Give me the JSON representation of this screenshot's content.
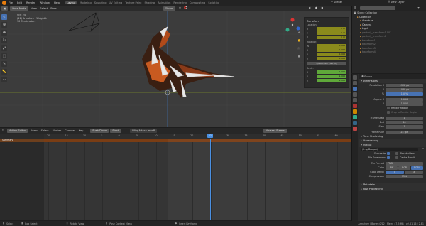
{
  "topbar": {
    "menus": [
      "File",
      "Edit",
      "Render",
      "Window",
      "Help"
    ],
    "tabs": [
      "Layout",
      "Modeling",
      "Sculpting",
      "UV Editing",
      "Texture Paint",
      "Shading",
      "Animation",
      "Rendering",
      "Compositing",
      "Scripting"
    ],
    "active_tab": "Layout",
    "scene": "Scene",
    "view_layer": "View Layer"
  },
  "viewport": {
    "mode": "Pose Mode",
    "menus": [
      "View",
      "Select",
      "Pose"
    ],
    "orientation": "Global",
    "info_line1": "Scr: 24",
    "info_line2": "(11) Armature : Weight L",
    "info_line3": "10 Centimeters",
    "npanel": {
      "title": "Transform",
      "location_label": "Location:",
      "location": [
        "0 m",
        "0 m",
        "0 m"
      ],
      "rotation_label": "Rotation:",
      "rotation": [
        "0.000",
        "0.000",
        "0.000",
        "0.000"
      ],
      "quaternion": "Quaternion (WXYZ)",
      "scale_label": "Scale:",
      "scale": [
        "1.000",
        "1.000",
        "1.000"
      ],
      "axes": [
        "X",
        "Y",
        "Z",
        "W"
      ]
    }
  },
  "outliner": {
    "title": "Scene Collection",
    "items": [
      {
        "label": "Collection",
        "indent": 1,
        "color": "#ddd"
      },
      {
        "label": "Armature",
        "indent": 2,
        "color": "#ddd"
      },
      {
        "label": "Camera",
        "indent": 2,
        "color": "#ddd"
      },
      {
        "label": "Light",
        "indent": 2,
        "color": "#ddd"
      },
      {
        "label": "pasted__transform1.001",
        "indent": 2,
        "color": "#777"
      },
      {
        "label": "pasted__transform6",
        "indent": 2,
        "color": "#777"
      },
      {
        "label": "transform1",
        "indent": 2,
        "color": "#777"
      },
      {
        "label": "transform2",
        "indent": 2,
        "color": "#777"
      },
      {
        "label": "transform3",
        "indent": 2,
        "color": "#777"
      },
      {
        "label": "transform4",
        "indent": 2,
        "color": "#777"
      }
    ]
  },
  "properties": {
    "scene_label": "Scene",
    "dimensions": "Dimensions",
    "res_x_label": "Resolution X",
    "res_x": "1920 px",
    "res_y_label": "Y",
    "res_y": "1080 px",
    "res_pct_label": "%",
    "res_pct": "100%",
    "aspect_x_label": "Aspect X",
    "aspect_x": "1.000",
    "aspect_y_label": "Y",
    "aspect_y": "1.000",
    "render_region": "Render Region",
    "crop_to_region": "Crop to Render Region",
    "frame_start_label": "Frame Start",
    "frame_start": "1",
    "frame_end_label": "End",
    "frame_end": "40",
    "frame_step_label": "Step",
    "frame_step": "1",
    "frame_rate_label": "Frame Rate",
    "frame_rate": "24 fps",
    "time_stretching": "Time Stretching",
    "stereoscopy": "Stereoscopy",
    "output": "Output",
    "output_path": "/tmp/Dragon\\",
    "overwrite": "Overwrite",
    "placeholders": "Placeholders",
    "file_extensions": "File Extensions",
    "cache_result": "Cache Result",
    "file_format_label": "File Format",
    "file_format": "PNG",
    "color_label": "Color",
    "color_opts": [
      "BW",
      "RGB",
      "RGBA"
    ],
    "color_depth_label": "Color Depth",
    "color_depth": [
      "8",
      "16"
    ],
    "compression_label": "Compression",
    "compression": "15%",
    "metadata": "Metadata",
    "post_processing": "Post Processing"
  },
  "action_editor": {
    "editor": "Action Editor",
    "menus": [
      "View",
      "Select",
      "Marker",
      "Channel",
      "Key"
    ],
    "push_down": "Push Down",
    "stash": "Stash",
    "action_name": "WingAttack.mod8",
    "nearest_frame": "Nearest Frame",
    "summary": "Summary",
    "current_frame": "11",
    "ticks": [
      "-20",
      "-15",
      "-10",
      "-5",
      "0",
      "5",
      "10",
      "15",
      "20",
      "25",
      "30",
      "35",
      "40",
      "45",
      "50",
      "55",
      "60"
    ]
  },
  "statusbar": {
    "left1": "Select",
    "left2": "Box Select",
    "mid1": "Rotate View",
    "mid2": "Pose Context Menu",
    "mid3": "Insert Keyframe",
    "right": "Armature | Bones:0/12 | Mem: 47.5 MB | v2.81.16 | 2.81"
  },
  "colors": {
    "accent": "#4772b3",
    "summary_bar": "#cc6619",
    "playhead": "#4a90e2",
    "np_yellow": "#8b8b1c",
    "np_green": "#5fa83a"
  }
}
